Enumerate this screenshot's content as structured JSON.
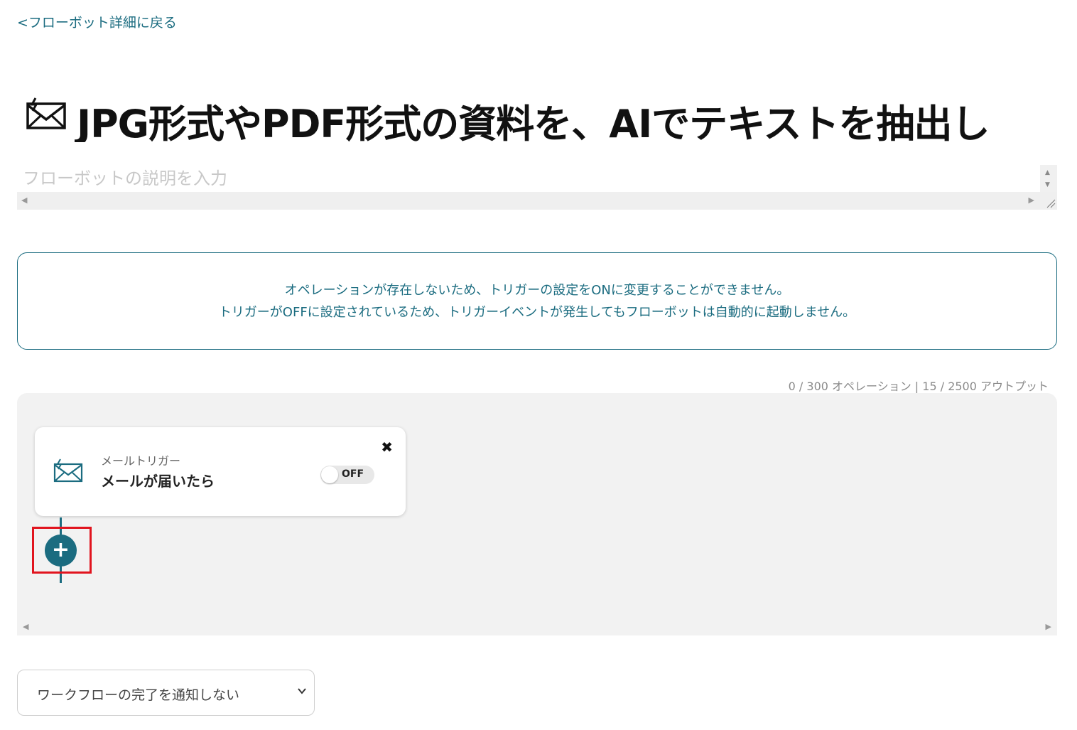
{
  "nav": {
    "back_link": "<フローボット詳細に戻る"
  },
  "header": {
    "title": "JPG形式やPDF形式の資料を、AIでテキストを抽出し",
    "icon": "mail-trigger-icon"
  },
  "description": {
    "placeholder": "フローボットの説明を入力",
    "value": ""
  },
  "notice": {
    "line1": "オペレーションが存在しないため、トリガーの設定をONに変更することができません。",
    "line2": "トリガーがOFFに設定されているため、トリガーイベントが発生してもフローボットは自動的に起動しません。"
  },
  "usage": {
    "text": "0 / 300 オペレーション | 15 / 2500 アウトプット"
  },
  "flow": {
    "trigger": {
      "label": "メールトリガー",
      "title": "メールが届いたら",
      "toggle_state": "OFF",
      "icon": "mail-trigger-icon",
      "close_icon": "close-icon"
    },
    "add_button_icon": "plus-icon"
  },
  "notify": {
    "selected": "ワークフローの完了を通知しない"
  },
  "colors": {
    "accent": "#1b6c80",
    "highlight": "#e1141e",
    "canvas_bg": "#f2f2f2"
  }
}
